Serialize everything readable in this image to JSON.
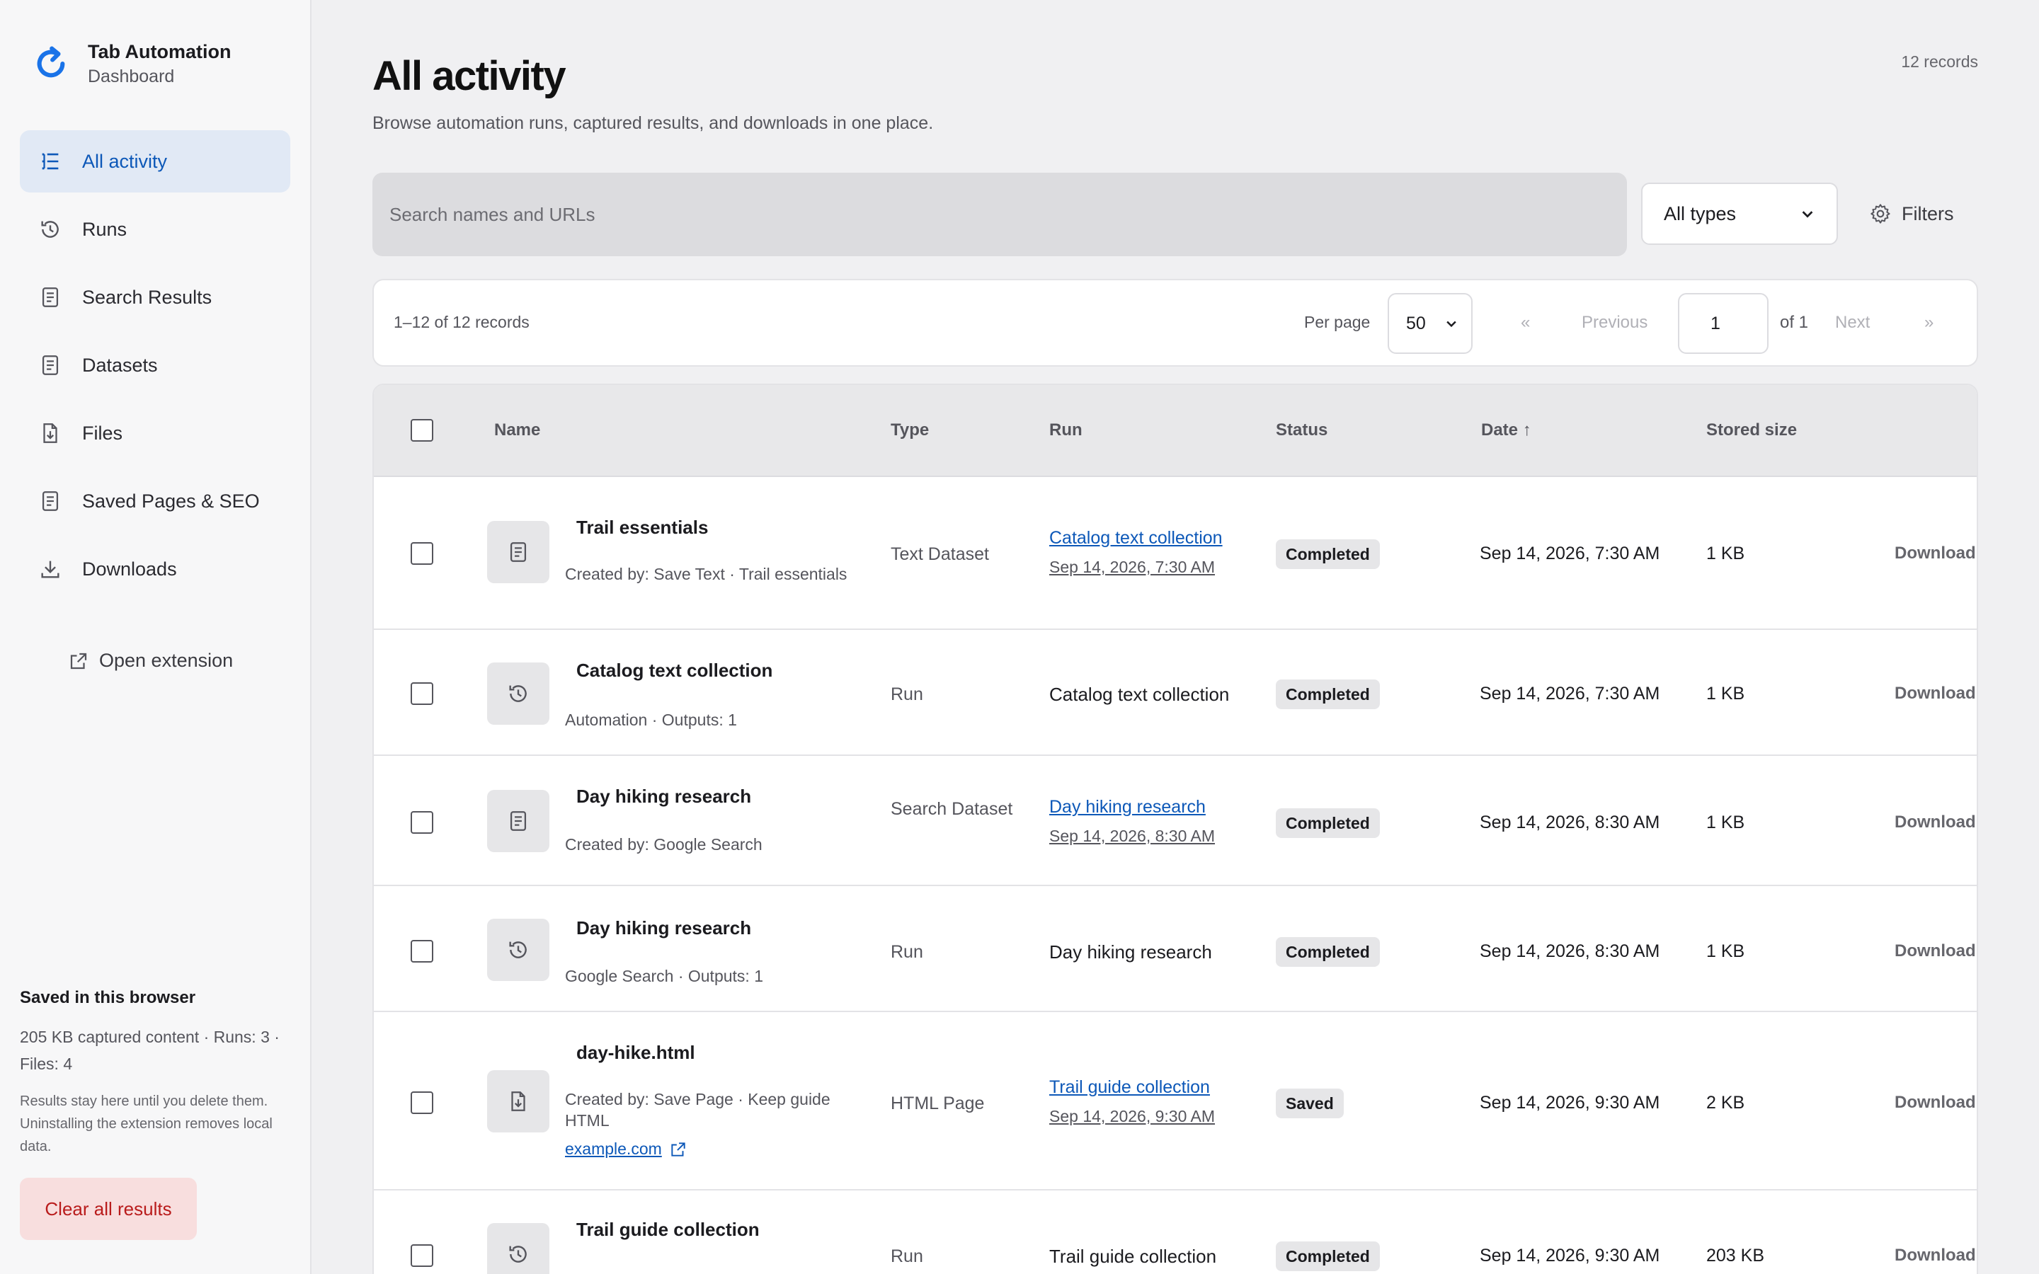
{
  "app": {
    "title": "Tab Automation",
    "subtitle": "Dashboard"
  },
  "sidebar": {
    "items": [
      {
        "label": "All activity",
        "icon": "list-icon",
        "active": true
      },
      {
        "label": "Runs",
        "icon": "history-icon"
      },
      {
        "label": "Search Results",
        "icon": "document-icon"
      },
      {
        "label": "Datasets",
        "icon": "document-icon"
      },
      {
        "label": "Files",
        "icon": "file-download-icon"
      },
      {
        "label": "Saved Pages & SEO",
        "icon": "document-icon"
      },
      {
        "label": "Downloads",
        "icon": "download-icon"
      }
    ],
    "open_extension": "Open extension",
    "saved": {
      "title": "Saved in this browser",
      "stats": "205 KB captured content · Runs: 3 · Files: 4",
      "note": "Results stay here until you delete them. Uninstalling the extension removes local data."
    },
    "clear_label": "Clear all results"
  },
  "main": {
    "title": "All activity",
    "subtitle": "Browse automation runs, captured results, and downloads in one place.",
    "records_count": "12 records",
    "search_placeholder": "Search names and URLs",
    "type_select": "All types",
    "filters_label": "Filters"
  },
  "pager": {
    "range": "1–12 of 12 records",
    "per_page_label": "Per page",
    "per_page": "50",
    "first": "«",
    "previous": "Previous",
    "page": "1",
    "of": "of 1",
    "next": "Next",
    "last": "»"
  },
  "table": {
    "headers": {
      "name": "Name",
      "type": "Type",
      "run": "Run",
      "status": "Status",
      "date": "Date ↑",
      "size": "Stored size"
    },
    "rows": [
      {
        "name": "Trail essentials",
        "meta": "Created by: Save Text · Trail essentials",
        "type": "Text Dataset",
        "run_link": "Catalog text collection",
        "run_date": "Sep 14, 2026, 7:30 AM",
        "status": "Completed",
        "date": "Sep 14, 2026, 7:30 AM",
        "size": "1 KB",
        "download": "Download",
        "icon": "document-icon"
      },
      {
        "name": "Catalog text collection",
        "meta": "Automation · Outputs: 1",
        "type": "Run",
        "run_text": "Catalog text collection",
        "status": "Completed",
        "date": "Sep 14, 2026, 7:30 AM",
        "size": "1 KB",
        "download": "Download",
        "icon": "history-icon"
      },
      {
        "name": "Day hiking research",
        "meta": "Created by: Google Search",
        "type": "Search Dataset",
        "run_link": "Day hiking research",
        "run_date": "Sep 14, 2026, 8:30 AM",
        "status": "Completed",
        "date": "Sep 14, 2026, 8:30 AM",
        "size": "1 KB",
        "download": "Download",
        "icon": "document-icon"
      },
      {
        "name": "Day hiking research",
        "meta": "Google Search · Outputs: 1",
        "type": "Run",
        "run_text": "Day hiking research",
        "status": "Completed",
        "date": "Sep 14, 2026, 8:30 AM",
        "size": "1 KB",
        "download": "Download",
        "icon": "history-icon"
      },
      {
        "name": "day-hike.html",
        "meta": "Created by: Save Page · Keep guide HTML",
        "link": "example.com",
        "type": "HTML Page",
        "run_link": "Trail guide collection",
        "run_date": "Sep 14, 2026, 9:30 AM",
        "status": "Saved",
        "date": "Sep 14, 2026, 9:30 AM",
        "size": "2 KB",
        "download": "Download",
        "icon": "file-download-icon"
      },
      {
        "name": "Trail guide collection",
        "type": "Run",
        "run_text": "Trail guide collection",
        "status": "Completed",
        "date": "Sep 14, 2026, 9:30 AM",
        "size": "203 KB",
        "download": "Download",
        "icon": "history-icon"
      }
    ]
  },
  "colors": {
    "accent": "#0d58b8",
    "danger": "#b91c1c",
    "danger_bg": "#f8dede",
    "active_bg": "#e1e9f5"
  }
}
